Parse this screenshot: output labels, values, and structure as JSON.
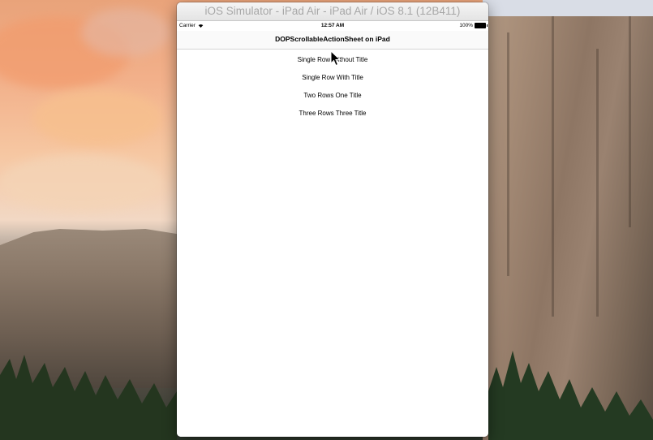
{
  "window": {
    "title": "iOS Simulator - iPad Air - iPad Air / iOS 8.1 (12B411)"
  },
  "status_bar": {
    "carrier": "Carrier",
    "time": "12:57 AM",
    "battery": "100%"
  },
  "navigation": {
    "title": "DOPScrollableActionSheet on iPad"
  },
  "menu": {
    "items": [
      {
        "label": "Single Row Without Title"
      },
      {
        "label": "Single Row With Title"
      },
      {
        "label": "Two Rows One Title"
      },
      {
        "label": "Three Rows Three Title"
      }
    ]
  },
  "icons": {
    "wifi": "wifi-icon",
    "battery": "battery-icon",
    "cursor": "mouse-cursor-icon"
  },
  "colors": {
    "window_title_text": "#a7a7a7",
    "screen_background": "#ffffff"
  }
}
